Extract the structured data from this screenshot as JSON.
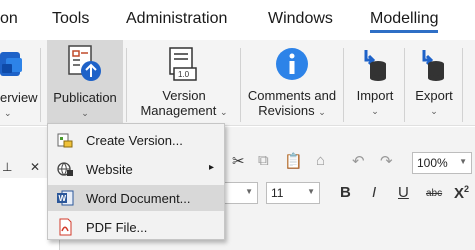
{
  "menu": {
    "tabs": [
      "on",
      "Tools",
      "Administration",
      "Windows",
      "Modelling"
    ]
  },
  "ribbon": {
    "overview_label": "erview",
    "publication_label": "Publication",
    "version_management": [
      "Version",
      "Management"
    ],
    "comments": [
      "Comments and",
      "Revisions"
    ],
    "import_label": "Import",
    "export_label": "Export"
  },
  "dropdown": {
    "items": [
      {
        "label": "Create Version...",
        "icon": "create-version-icon"
      },
      {
        "label": "Website",
        "icon": "website-icon",
        "submenu": "▸"
      },
      {
        "label": "Word Document...",
        "icon": "word-icon"
      },
      {
        "label": "PDF File...",
        "icon": "pdf-icon"
      }
    ]
  },
  "toolbar": {
    "zoom": "100%",
    "font_size": "11",
    "bold": "B",
    "italic": "I",
    "underline": "U",
    "strike": "abc",
    "superscript_x": "X"
  },
  "colors": {
    "accent": "#2f6fc6",
    "hover": "#d8d8d8"
  }
}
